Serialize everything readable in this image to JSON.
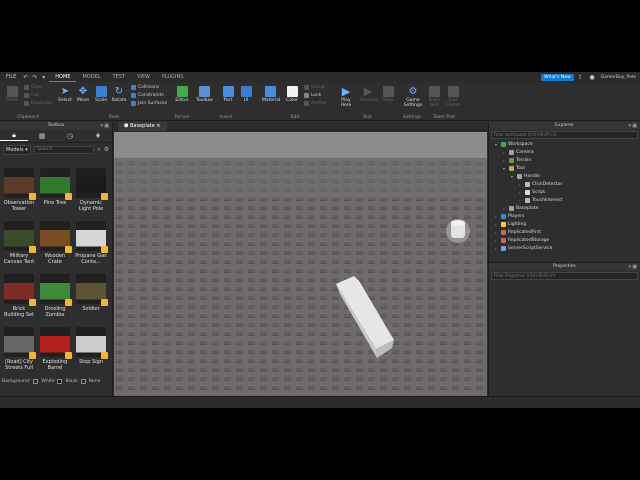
{
  "menubar": {
    "file": "FILE",
    "tabs": [
      "HOME",
      "MODEL",
      "TEST",
      "VIEW",
      "PLUGINS"
    ],
    "whats_new": "What's New",
    "user": "GamerBoy_Pole"
  },
  "ribbon": {
    "clipboard": {
      "label": "Clipboard",
      "paste": "Paste",
      "copy": "Copy",
      "cut": "Cut",
      "duplicate": "Duplicate"
    },
    "tools": {
      "label": "Tools",
      "select": "Select",
      "move": "Move",
      "scale": "Scale",
      "rotate": "Rotate",
      "collisions": "Collisions",
      "constraints": "Constraints",
      "join": "Join Surfaces"
    },
    "terrain": {
      "label": "Terrain",
      "editor": "Editor"
    },
    "insert": {
      "label": "Insert",
      "toolbox": "Toolbox",
      "part": "Part",
      "ui": "UI"
    },
    "edit": {
      "label": "Edit",
      "material": "Material",
      "color": "Color",
      "group": "Group",
      "lock": "Lock",
      "anchor": "Anchor"
    },
    "test": {
      "label": "Test",
      "play": "Play",
      "play_sub": "Here",
      "resume": "Resume",
      "stop": "Stop"
    },
    "settings": {
      "label": "Settings",
      "game": "Game",
      "game_sub": "Settings"
    },
    "team_test": {
      "label": "Team Test",
      "team": "Team",
      "team_sub": "Test",
      "exit": "Exit",
      "exit_sub": "Game"
    }
  },
  "toolbox": {
    "title": "Toolbox",
    "category": "Models",
    "search_placeholder": "Search",
    "items": [
      {
        "label": "Observation Tower",
        "color": "#5a3b2a"
      },
      {
        "label": "Pine Tree",
        "color": "#2f7a2c"
      },
      {
        "label": "Dynamic Light Pole",
        "color": "#1b1b1b"
      },
      {
        "label": "Military Canvas Tent",
        "color": "#3c4a2c"
      },
      {
        "label": "Wooden Crate",
        "color": "#7a4d22"
      },
      {
        "label": "Propane Gas Conta...",
        "color": "#d5d5d5"
      },
      {
        "label": "Brick Building Set",
        "color": "#7a2c25"
      },
      {
        "label": "Drooling Zombie",
        "color": "#3e8a3a"
      },
      {
        "label": "Soldier",
        "color": "#5b5535"
      },
      {
        "label": "[Road] City Streets Full",
        "color": "#666666"
      },
      {
        "label": "Exploding Barrel",
        "color": "#b42020"
      },
      {
        "label": "Stop Sign",
        "color": "#cccccc"
      }
    ],
    "background_label": "Background:",
    "bg_options": [
      "White",
      "Black",
      "None"
    ]
  },
  "viewport": {
    "tab": "Baseplate"
  },
  "explorer": {
    "title": "Explorer",
    "filter": "Filter workspace (Ctrl+Shift+X)",
    "items": [
      {
        "label": "Workspace",
        "depth": 0,
        "color": "#3fae4a"
      },
      {
        "label": "Camera",
        "depth": 1,
        "color": "#9aa3ad"
      },
      {
        "label": "Terrain",
        "depth": 1,
        "color": "#6b9a3a"
      },
      {
        "label": "Tool",
        "depth": 1,
        "color": "#c8a35a"
      },
      {
        "label": "Handle",
        "depth": 2,
        "color": "#9aa3ad"
      },
      {
        "label": "ClickDetector",
        "depth": 3,
        "color": "#bbbbbb"
      },
      {
        "label": "Script",
        "depth": 3,
        "color": "#dddddd"
      },
      {
        "label": "TouchInterest",
        "depth": 3,
        "color": "#bbbbbb"
      },
      {
        "label": "Baseplate",
        "depth": 1,
        "color": "#9aa3ad"
      },
      {
        "label": "Players",
        "depth": 0,
        "color": "#3a89d6"
      },
      {
        "label": "Lighting",
        "depth": 0,
        "color": "#f4d03f"
      },
      {
        "label": "ReplicatedFirst",
        "depth": 0,
        "color": "#c9665a"
      },
      {
        "label": "ReplicatedStorage",
        "depth": 0,
        "color": "#c9665a"
      },
      {
        "label": "ServerScriptService",
        "depth": 0,
        "color": "#7aa0d6"
      }
    ]
  },
  "properties": {
    "title": "Properties",
    "filter": "Filter Properties (Ctrl+Shift+P)"
  }
}
